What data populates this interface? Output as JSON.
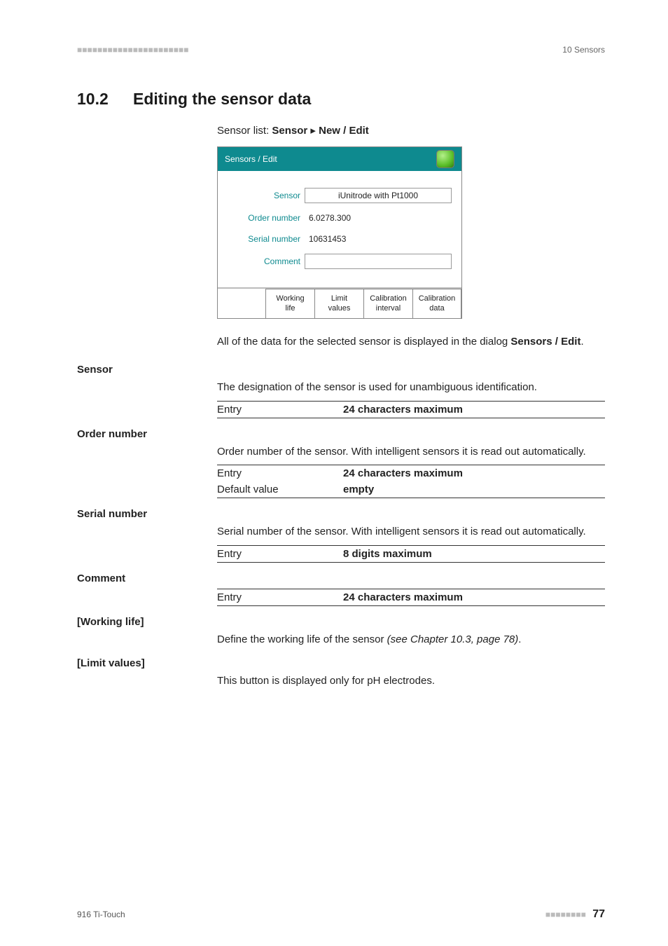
{
  "header": {
    "dashes": "■■■■■■■■■■■■■■■■■■■■■■",
    "right": "10 Sensors"
  },
  "section": {
    "number": "10.2",
    "title": "Editing the sensor data"
  },
  "intro": {
    "prefix": "Sensor list: ",
    "bold1": "Sensor",
    "arrow": " ▸ ",
    "bold2": "New / Edit"
  },
  "dialog": {
    "title": "Sensors / Edit",
    "rows": {
      "sensor_label": "Sensor",
      "sensor_value": "iUnitrode with Pt1000",
      "order_label": "Order number",
      "order_value": "6.0278.300",
      "serial_label": "Serial number",
      "serial_value": "10631453",
      "comment_label": "Comment",
      "comment_value": ""
    },
    "buttons": {
      "working_life": "Working\nlife",
      "limit_values": "Limit\nvalues",
      "cal_interval": "Calibration\ninterval",
      "cal_data": "Calibration\ndata"
    }
  },
  "after_dialog": {
    "p1a": "All of the data for the selected sensor is displayed in the dialog ",
    "p1b": "Sensors / Edit",
    "p1c": "."
  },
  "fields": {
    "sensor": {
      "name": "Sensor",
      "desc": "The designation of the sensor is used for unambiguous identification.",
      "entry_k": "Entry",
      "entry_v": "24 characters maximum"
    },
    "order": {
      "name": "Order number",
      "desc": "Order number of the sensor. With intelligent sensors it is read out automatically.",
      "entry_k": "Entry",
      "entry_v": "24 characters maximum",
      "def_k": "Default value",
      "def_v": "empty"
    },
    "serial": {
      "name": "Serial number",
      "desc": "Serial number of the sensor. With intelligent sensors it is read out automatically.",
      "entry_k": "Entry",
      "entry_v": "8 digits maximum"
    },
    "comment": {
      "name": "Comment",
      "entry_k": "Entry",
      "entry_v": "24 characters maximum"
    },
    "working": {
      "name": "[Working life]",
      "desc_a": "Define the working life of the sensor ",
      "desc_ref": "(see Chapter 10.3, page 78)",
      "desc_b": "."
    },
    "limit": {
      "name": "[Limit values]",
      "desc": "This button is displayed only for pH electrodes."
    }
  },
  "footer": {
    "left": "916 Ti-Touch",
    "dashes": "■■■■■■■■",
    "page": "77"
  }
}
